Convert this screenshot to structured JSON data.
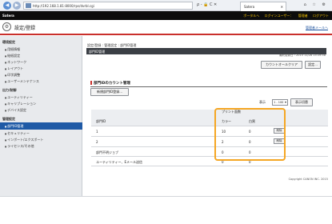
{
  "browser": {
    "url": "http://192.168.1.81:8000/rps/dvrbl.cgi",
    "tab_label": "Satera",
    "back_glyph": "◀",
    "forward_glyph": "▶",
    "addr_tools": "ρ - 🔒 C ✕",
    "close_glyph": "✕",
    "window_icons": "⌂ ☆ ⚙"
  },
  "topbar": {
    "brand": "Satera",
    "links": [
      "ポータルへ",
      "ログインユーザー：",
      "管理者",
      "ログアウト"
    ]
  },
  "header": {
    "title": "設定/登録",
    "portal_link": "管理者メールへ",
    "title_icon": "⚙"
  },
  "sidebar": {
    "groups": [
      {
        "label": "環境設定",
        "items": [
          "用紙情報",
          "給紙設定",
          "ネットワーク",
          "レイアウト",
          "印字調整",
          "ユーザーメンテナンス"
        ]
      },
      {
        "label": "出力/制御",
        "items": [
          "ユーティリティー",
          "キャリブレーション",
          "デバイス設定"
        ]
      },
      {
        "label": "管理設定",
        "items": [
          "部門ID管理",
          "セキュリティー",
          "インポート/エクスポート",
          "ライセンス/その他"
        ]
      }
    ],
    "active_item": "部門ID管理"
  },
  "content": {
    "breadcrumb": "設定/登録 : 管理設定 : 部門ID管理",
    "panel_title": "部門ID管理",
    "last_update": "最終更新日 : 2015 11/28 15:39:58",
    "btn_clear_all": "カウントオールクリア",
    "btn_settings": "設定...",
    "section_title": "部門IDのカウント管理",
    "btn_register": "新規部門ID登録...",
    "display_label": "表示",
    "display_value": "1 - 100",
    "btn_display": "表示切替",
    "table": {
      "col_dept": "部門ID",
      "col_print_group": "プリント面数",
      "col_color": "カラー",
      "col_bw": "白黒",
      "rows": [
        {
          "dept": "1",
          "color": "10",
          "bw": "0",
          "button": "削除"
        },
        {
          "dept": "2",
          "color": "2",
          "bw": "0",
          "button": "削除"
        },
        {
          "dept": "部門不明ジョブ",
          "color": "0",
          "bw": "0",
          "button": ""
        },
        {
          "dept": "ユーティリティー、Eメール送信",
          "color": "0",
          "bw": "0",
          "button": ""
        }
      ]
    },
    "highlight_color": "#f5a623"
  },
  "footer": {
    "copyright": "Copyright CANON INC. 2015"
  }
}
